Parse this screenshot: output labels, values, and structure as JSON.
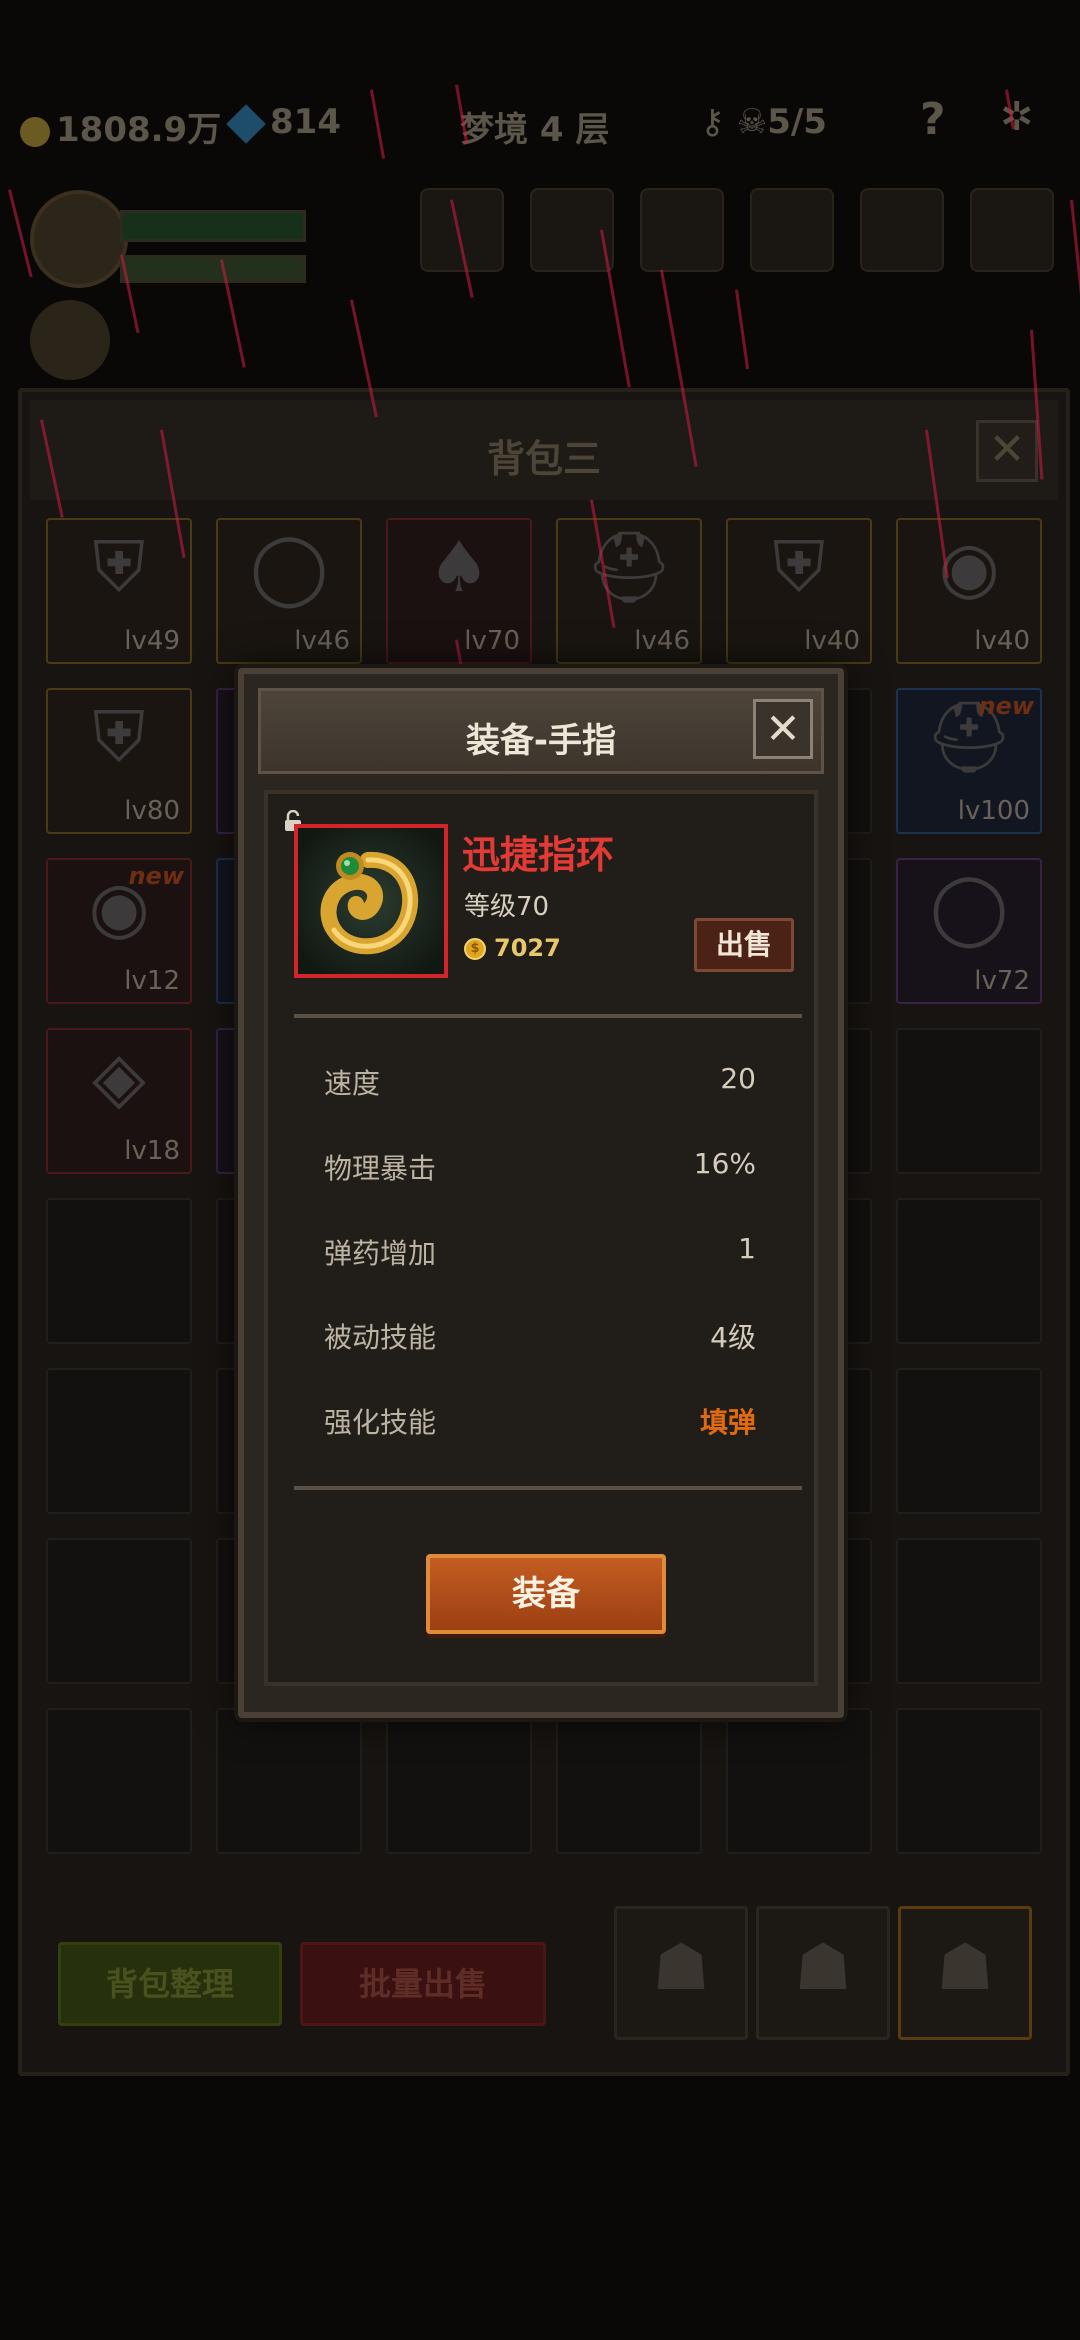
{
  "topbar": {
    "gold": "1808.9万",
    "gems": "814",
    "floor": "梦境 4 层",
    "counter": "5/5",
    "help": "?"
  },
  "backpack": {
    "title": "背包三",
    "close": "✕",
    "items": [
      {
        "level": "lv49",
        "rarity": "gold",
        "icon": "armor-icon",
        "glyph": "⛨"
      },
      {
        "level": "lv46",
        "rarity": "gold",
        "icon": "ring-icon",
        "glyph": "◯"
      },
      {
        "level": "lv70",
        "rarity": "red",
        "icon": "cloak-icon",
        "glyph": "♠"
      },
      {
        "level": "lv46",
        "rarity": "gold",
        "icon": "helmet-icon",
        "glyph": "⛑"
      },
      {
        "level": "lv40",
        "rarity": "gold",
        "icon": "armor-icon",
        "glyph": "⛨"
      },
      {
        "level": "lv40",
        "rarity": "gold",
        "icon": "shield-icon",
        "glyph": "◉"
      },
      {
        "level": "lv80",
        "rarity": "gold",
        "icon": "armor-icon",
        "glyph": "⛨"
      },
      {
        "level": "lv100",
        "rarity": "blue",
        "icon": "helmet-icon",
        "glyph": "⛑",
        "badge": "new"
      },
      {
        "level": "lv12",
        "rarity": "red",
        "icon": "shield-icon",
        "glyph": "◉",
        "badge": "new"
      },
      {
        "level": "lv72",
        "rarity": "purple",
        "icon": "ring-icon",
        "glyph": "◯"
      },
      {
        "level": "lv18",
        "rarity": "red",
        "icon": "ring-icon",
        "glyph": "◈"
      }
    ],
    "sort_button": "背包整理",
    "bulk_sell_button": "批量出售"
  },
  "modal": {
    "title": "装备-手指",
    "close": "✕",
    "item_name": "迅捷指环",
    "item_level": "等级70",
    "coin_symbol": "$",
    "price": "7027",
    "sell_button": "出售",
    "stats": [
      {
        "name": "速度",
        "value": "20"
      },
      {
        "name": "物理暴击",
        "value": "16%"
      },
      {
        "name": "弹药增加",
        "value": "1"
      },
      {
        "name": "被动技能",
        "value": "4级"
      },
      {
        "name": "强化技能",
        "value": "填弹",
        "highlight": true
      }
    ],
    "equip_button": "装备"
  },
  "colors": {
    "item_name": "#e33a35",
    "highlight": "#e06a10",
    "equip_button": "#b44f1b",
    "rarity_frame": "#d4242a"
  }
}
